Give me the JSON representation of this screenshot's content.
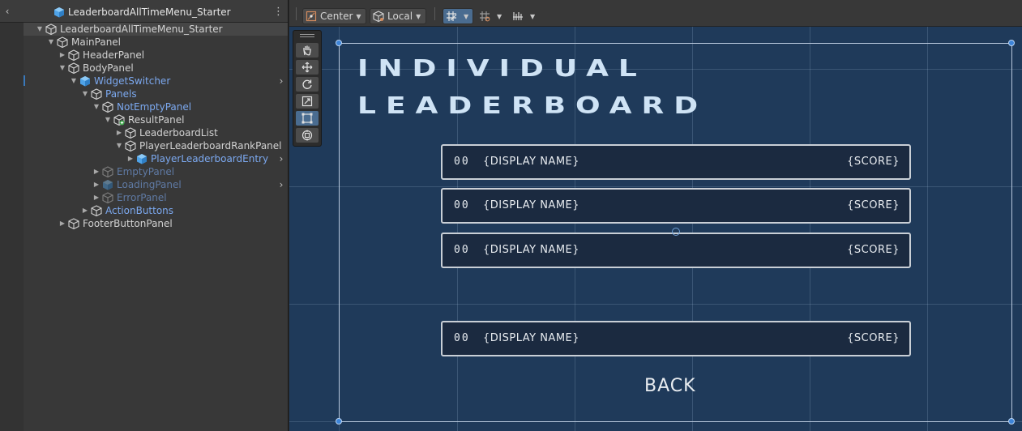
{
  "hierarchy": {
    "scene_title": "LeaderboardAllTimeMenu_Starter",
    "back_icon": "chevron-left-icon",
    "menu_icon": "kebab-menu-icon",
    "items": [
      {
        "label": "LeaderboardAllTimeMenu_Starter",
        "icon": "gameobject-cube-icon",
        "arrow": "expanded",
        "style": "normal"
      },
      {
        "label": "MainPanel",
        "icon": "gameobject-cube-icon",
        "arrow": "expanded",
        "style": "normal"
      },
      {
        "label": "HeaderPanel",
        "icon": "gameobject-cube-icon",
        "arrow": "collapsed",
        "style": "normal"
      },
      {
        "label": "BodyPanel",
        "icon": "gameobject-cube-icon",
        "arrow": "expanded",
        "style": "normal"
      },
      {
        "label": "WidgetSwitcher",
        "icon": "prefab-cube-icon",
        "arrow": "expanded",
        "style": "prefab",
        "chevron": true
      },
      {
        "label": "Panels",
        "icon": "gameobject-cube-icon",
        "arrow": "expanded",
        "style": "prefab"
      },
      {
        "label": "NotEmptyPanel",
        "icon": "gameobject-cube-icon",
        "arrow": "expanded",
        "style": "prefab"
      },
      {
        "label": "ResultPanel",
        "icon": "added-gameobject-icon",
        "arrow": "expanded",
        "style": "normal"
      },
      {
        "label": "LeaderboardList",
        "icon": "gameobject-cube-icon",
        "arrow": "collapsed",
        "style": "normal"
      },
      {
        "label": "PlayerLeaderboardRankPanel",
        "icon": "gameobject-cube-icon",
        "arrow": "expanded",
        "style": "normal"
      },
      {
        "label": "PlayerLeaderboardEntry",
        "icon": "prefab-cube-icon",
        "arrow": "collapsed",
        "style": "prefab",
        "chevron": true
      },
      {
        "label": "EmptyPanel",
        "icon": "gameobject-cube-icon",
        "arrow": "collapsed",
        "style": "dim"
      },
      {
        "label": "LoadingPanel",
        "icon": "prefab-cube-icon",
        "arrow": "collapsed",
        "style": "dim",
        "chevron": true
      },
      {
        "label": "ErrorPanel",
        "icon": "gameobject-cube-icon",
        "arrow": "collapsed",
        "style": "dim"
      },
      {
        "label": "ActionButtons",
        "icon": "gameobject-cube-icon",
        "arrow": "collapsed",
        "style": "prefab"
      },
      {
        "label": "FooterButtonPanel",
        "icon": "gameobject-cube-icon",
        "arrow": "collapsed",
        "style": "normal"
      }
    ]
  },
  "toolbar": {
    "pivot_label": "Center",
    "pivot_icon": "pivot-center-icon",
    "space_label": "Local",
    "space_icon": "local-space-icon",
    "grid_snap_icon": "grid-snap-icon",
    "grid_icon": "grid-visibility-icon",
    "increment_snap_icon": "increment-snap-icon"
  },
  "tools": [
    "view-hand-icon",
    "move-tool-icon",
    "rotate-tool-icon",
    "scale-tool-icon",
    "rect-tool-icon",
    "transform-tool-icon"
  ],
  "scene": {
    "title_line1": "INDIVIDUAL",
    "title_line2": "LEADERBOARD",
    "entries": [
      {
        "rank": "00",
        "name": "{DISPLAY NAME}",
        "score": "{SCORE}"
      },
      {
        "rank": "00",
        "name": "{DISPLAY NAME}",
        "score": "{SCORE}"
      },
      {
        "rank": "00",
        "name": "{DISPLAY NAME}",
        "score": "{SCORE}"
      },
      {
        "rank": "00",
        "name": "{DISPLAY NAME}",
        "score": "{SCORE}"
      }
    ],
    "back_label": "BACK"
  },
  "colors": {
    "scene_background": "#1f3a5a",
    "prefab_text": "#7ca9f0",
    "inactive_text": "#5f7aa4",
    "selection_handle": "#3d84d8"
  }
}
